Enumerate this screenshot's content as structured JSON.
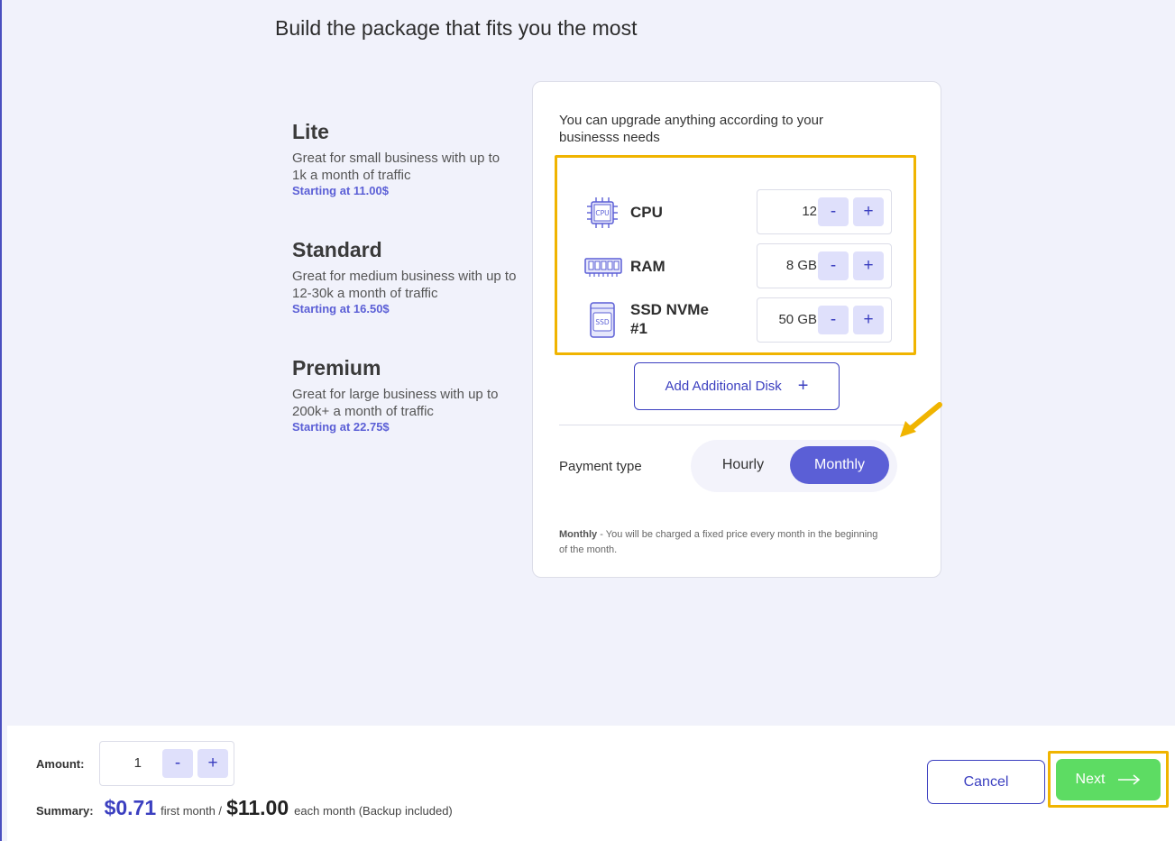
{
  "page": {
    "title": "Build the package that fits you the most"
  },
  "plans": [
    {
      "name": "Lite",
      "description": "Great for small business with up to 1k a month of traffic",
      "price": "Starting at 11.00$"
    },
    {
      "name": "Standard",
      "description": "Great for medium business with up to 12-30k a month of traffic",
      "price": "Starting at 16.50$"
    },
    {
      "name": "Premium",
      "description": "Great for large business with up to 200k+ a month of traffic",
      "price": "Starting at 22.75$"
    }
  ],
  "config": {
    "intro": "You can upgrade anything according to your businesss needs",
    "resources": [
      {
        "label": "CPU",
        "value": "12",
        "icon": "cpu-icon",
        "icon_text": "CPU"
      },
      {
        "label": "RAM",
        "value": "8 GB",
        "icon": "ram-icon"
      },
      {
        "label": "SSD NVMe\n#1",
        "value": "50 GB",
        "icon": "ssd-icon",
        "icon_text": "SSD"
      }
    ],
    "stepper": {
      "minus": "-",
      "plus": "+"
    },
    "add_disk_label": "Add Additional Disk",
    "add_disk_glyph": "+",
    "payment": {
      "label": "Payment type",
      "options": [
        "Hourly",
        "Monthly"
      ],
      "selected": "Monthly",
      "note_title": "Monthly",
      "note_text": " - You will be charged a fixed price every month in the beginning of the month."
    }
  },
  "footer": {
    "amount_label": "Amount:",
    "amount_value": "1",
    "summary_label": "Summary:",
    "first_price": "$0.71",
    "first_text": "first month /",
    "month_price": "$11.00",
    "month_text": "each month (Backup included)",
    "cancel_label": "Cancel",
    "next_label": "Next",
    "next_icon": "arrow-right-icon"
  },
  "colors": {
    "accent": "#5b5fd6",
    "primary_dark": "#3b3fc0",
    "highlight": "#f0b400",
    "success": "#5ddc63",
    "background": "#f1f2fb"
  }
}
